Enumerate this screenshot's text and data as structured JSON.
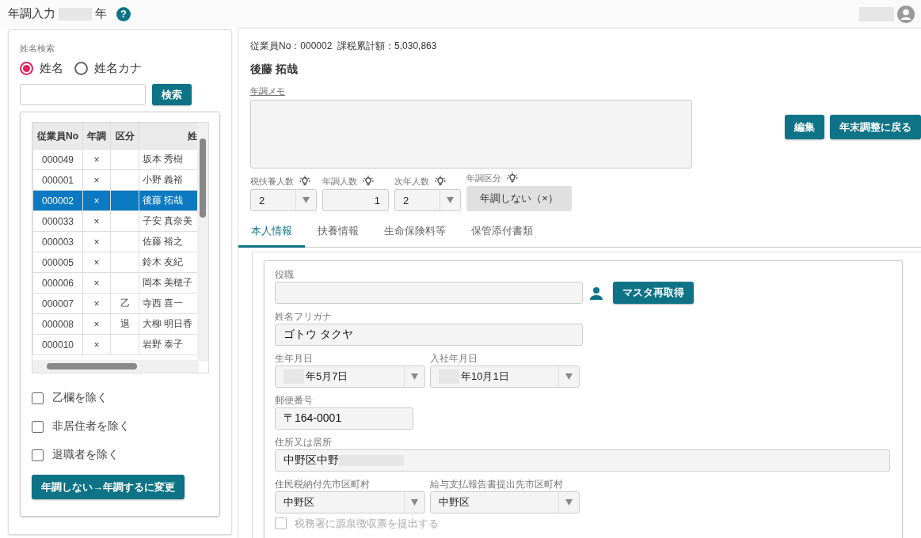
{
  "header": {
    "title": "年調入力",
    "title_suffix": "年",
    "help": "?"
  },
  "search": {
    "label": "姓名検索",
    "modes": [
      {
        "label": "姓名",
        "selected": true
      },
      {
        "label": "姓名カナ",
        "selected": false
      }
    ],
    "button": "検索"
  },
  "employee_table": {
    "columns": [
      "従業員No",
      "年調",
      "区分",
      "姓"
    ],
    "rows": [
      {
        "no": "000049",
        "nencho": "×",
        "name": "坂本 秀樹",
        "selected": false
      },
      {
        "no": "000001",
        "nencho": "×",
        "name": "小野 義裕",
        "selected": false
      },
      {
        "no": "000002",
        "nencho": "×",
        "name": "後藤 拓哉",
        "selected": true
      },
      {
        "no": "000033",
        "nencho": "×",
        "name": "子安 真奈美",
        "selected": false
      },
      {
        "no": "000003",
        "nencho": "×",
        "name": "佐藤 裕之",
        "selected": false
      },
      {
        "no": "000005",
        "nencho": "×",
        "name": "鈴木 友紀",
        "selected": false
      },
      {
        "no": "000006",
        "nencho": "×",
        "name": "岡本 美穂子",
        "selected": false
      },
      {
        "no": "000007",
        "nencho": "×",
        "kubun": "乙",
        "name": "寺西 喜一",
        "selected": false
      },
      {
        "no": "000008",
        "nencho": "×",
        "kubun": "退",
        "name": "大柳 明日香",
        "selected": false
      },
      {
        "no": "000010",
        "nencho": "×",
        "name": "岩野 泰子",
        "selected": false
      }
    ]
  },
  "filters": [
    {
      "label": "乙欄を除く",
      "checked": false
    },
    {
      "label": "非居住者を除く",
      "checked": false
    },
    {
      "label": "退職者を除く",
      "checked": false
    }
  ],
  "change_button": "年調しない→年調するに変更",
  "employee": {
    "summary": "従業員No：000002  課税累計額：5,030,863",
    "name": "後藤 拓哉",
    "memo_label": "年調メモ",
    "buttons": [
      "編集",
      "年末調整に戻る"
    ],
    "counts": [
      {
        "kind": "select",
        "label": "税扶養人数",
        "value": "2"
      },
      {
        "kind": "number",
        "label": "年調人数",
        "value": "1"
      },
      {
        "kind": "select",
        "label": "次年人数",
        "value": "2"
      },
      {
        "kind": "status",
        "label": "年調区分",
        "value": "年調しない（×）"
      }
    ]
  },
  "tabs": [
    {
      "label": "本人情報",
      "selected": true
    },
    {
      "label": "扶養情報",
      "selected": false
    },
    {
      "label": "生命保険料等",
      "selected": false
    },
    {
      "label": "保管添付書類",
      "selected": false
    }
  ],
  "form": {
    "position": {
      "label": "役職",
      "button": "マスタ再取得"
    },
    "kana": {
      "label": "姓名フリガナ",
      "value": "ゴトウ タクヤ"
    },
    "dates": [
      {
        "label": "生年月日",
        "value": "年5月7日"
      },
      {
        "label": "入社年月日",
        "value": "年10月1日"
      }
    ],
    "postal": {
      "label": "郵便番号",
      "value": "〒164-0001"
    },
    "address": {
      "label": "住所又は居所",
      "value": "中野区中野"
    },
    "municipalities": [
      {
        "label": "住民税納付先市区町村",
        "value": "中野区"
      },
      {
        "label": "給与支払報告書提出先市区町村",
        "value": "中野区"
      }
    ],
    "submit_check": {
      "label": "税務署に源泉徴収票を提出する",
      "checked": false
    }
  }
}
